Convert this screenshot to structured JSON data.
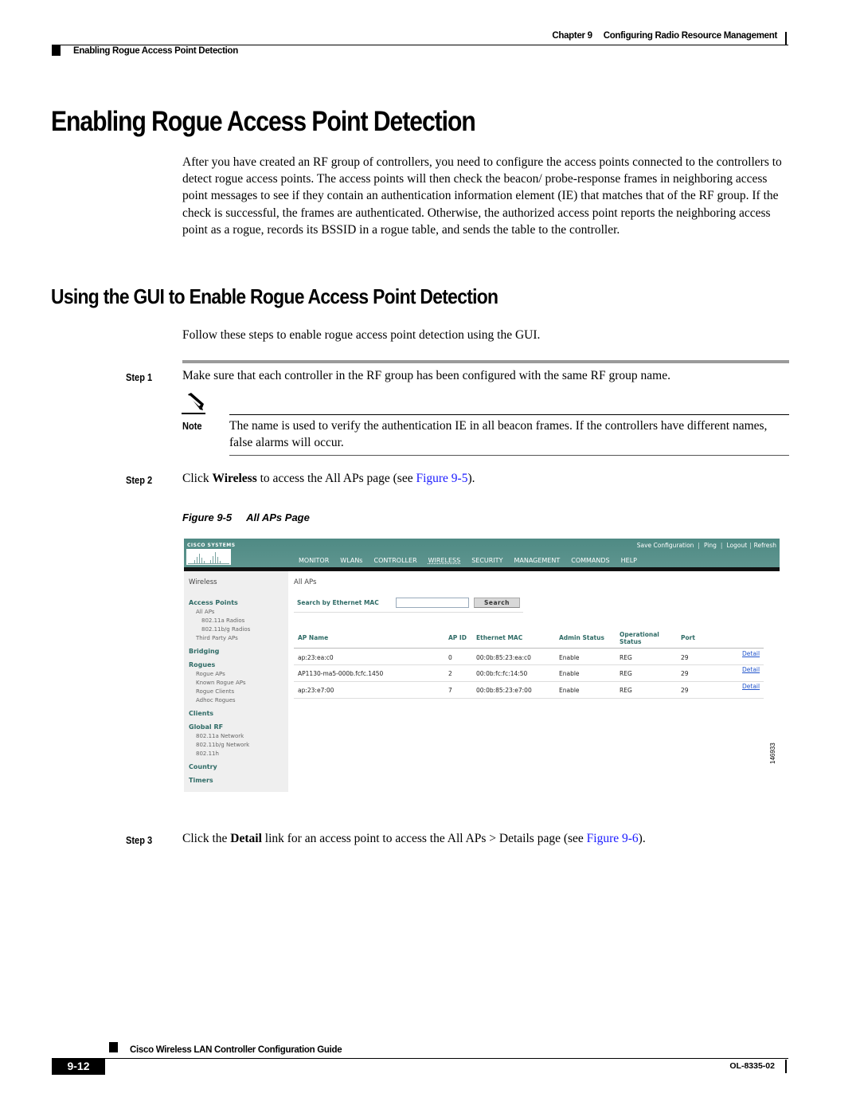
{
  "header": {
    "chapter": "Chapter 9",
    "chapter_title": "Configuring Radio Resource Management",
    "section": "Enabling Rogue Access Point Detection"
  },
  "title": "Enabling Rogue Access Point Detection",
  "intro": "After you have created an RF group of controllers, you need to configure the access points connected to the controllers to detect rogue access points. The access points will then check the beacon/ probe-response frames in neighboring access point messages to see if they contain an authentication information element (IE) that matches that of the RF group. If the check is successful, the frames are authenticated. Otherwise, the authorized access point reports the neighboring access point as a rogue, records its BSSID in a rogue table, and sends the table to the controller.",
  "subtitle": "Using the GUI to Enable Rogue Access Point Detection",
  "follow": "Follow these steps to enable rogue access point detection using the GUI.",
  "steps": [
    {
      "label": "Step 1",
      "text": "Make sure that each controller in the RF group has been configured with the same RF group name."
    },
    {
      "label": "Step 2",
      "pre": "Click ",
      "bold": "Wireless",
      "mid": " to access the All APs page (see ",
      "link": "Figure 9-5",
      "post": ")."
    },
    {
      "label": "Step 3",
      "pre": "Click the ",
      "bold": "Detail",
      "mid": " link for an access point to access the All APs > Details page (see ",
      "link": "Figure 9-6",
      "post": ")."
    }
  ],
  "note": {
    "label": "Note",
    "text": "The name is used to verify the authentication IE in all beacon frames. If the controllers have different names, false alarms will occur."
  },
  "figure": {
    "number": "Figure 9-5",
    "title": "All APs Page",
    "id_code": "146933"
  },
  "screenshot": {
    "logo": "Cisco Systems",
    "top_links": [
      "Save Configuration",
      "Ping",
      "Logout",
      "Refresh"
    ],
    "nav": [
      "MONITOR",
      "WLANs",
      "CONTROLLER",
      "WIRELESS",
      "SECURITY",
      "MANAGEMENT",
      "COMMANDS",
      "HELP"
    ],
    "active_nav": "WIRELESS",
    "sidebar": {
      "title": "Wireless",
      "access_points": "Access Points",
      "all_aps": "All APs",
      "radios_a": "802.11a Radios",
      "radios_bg": "802.11b/g Radios",
      "third_party": "Third Party APs",
      "bridging": "Bridging",
      "rogues": "Rogues",
      "rogue_aps": "Rogue APs",
      "known_rogue": "Known Rogue APs",
      "rogue_clients": "Rogue Clients",
      "adhoc": "Adhoc Rogues",
      "clients": "Clients",
      "global_rf": "Global RF",
      "net_a": "802.11a Network",
      "net_bg": "802.11b/g Network",
      "net_h": "802.11h",
      "country": "Country",
      "timers": "Timers"
    },
    "page_title": "All APs",
    "search_label": "Search by Ethernet MAC",
    "search_value": "",
    "search_button": "Search",
    "columns": [
      "AP Name",
      "AP ID",
      "Ethernet MAC",
      "Admin Status",
      "Operational Status",
      "Port"
    ],
    "rows": [
      {
        "name": "ap:23:ea:c0",
        "id": "0",
        "mac": "00:0b:85:23:ea:c0",
        "admin": "Enable",
        "oper": "REG",
        "port": "29",
        "link": "Detail"
      },
      {
        "name": "AP1130-ma5-000b.fcfc.1450",
        "id": "2",
        "mac": "00:0b:fc:fc:14:50",
        "admin": "Enable",
        "oper": "REG",
        "port": "29",
        "link": "Detail"
      },
      {
        "name": "ap:23:e7:00",
        "id": "7",
        "mac": "00:0b:85:23:e7:00",
        "admin": "Enable",
        "oper": "REG",
        "port": "29",
        "link": "Detail"
      }
    ]
  },
  "footer": {
    "guide": "Cisco Wireless LAN Controller Configuration Guide",
    "page": "9-12",
    "doc": "OL-8335-02"
  }
}
